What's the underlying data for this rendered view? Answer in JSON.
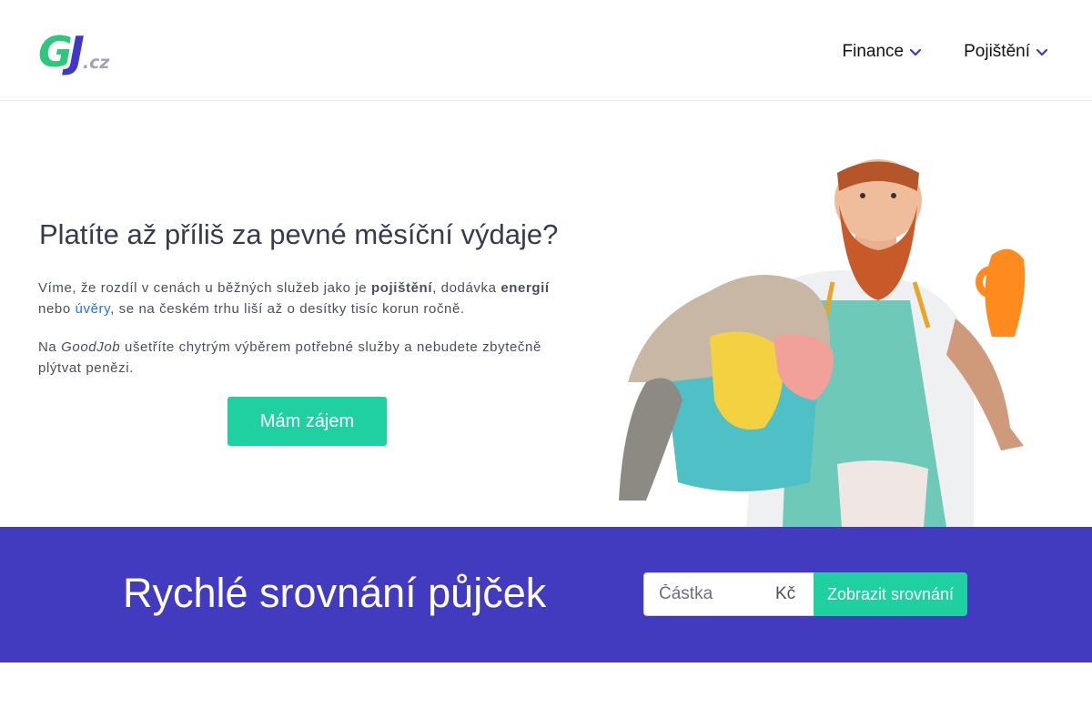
{
  "header": {
    "logo": {
      "main": "GJ",
      "suffix": ".cz"
    },
    "nav": [
      {
        "label": "Finance",
        "icon": "chevron-down-icon"
      },
      {
        "label": "Pojištění",
        "icon": "chevron-down-icon"
      }
    ]
  },
  "hero": {
    "title": "Platíte až příliš za pevné měsíční výdaje?",
    "p1": {
      "t1": "Víme, že rozdíl v cenách u běžných služeb jako je ",
      "b1": "pojištění",
      "t2": ", dodávka ",
      "b2": "energií",
      "t3": " nebo ",
      "link": "úvěry",
      "t4": ", se na českém trhu liší až o desítky tisíc korun ročně."
    },
    "p2": {
      "t1": "Na ",
      "brand": "GoodJob",
      "t2": " ušetříte chytrým výběrem potřebné služby a nebudete zbytečně plýtvat penězi."
    },
    "cta_label": "Mám zájem"
  },
  "compare": {
    "title": "Rychlé srovnání půjček",
    "amount_placeholder": "Částka",
    "unit": "Kč",
    "button_label": "Zobrazit srovnání"
  },
  "colors": {
    "brand_green": "#1fd1a0",
    "brand_purple": "#423bc0",
    "link": "#1a73e8"
  }
}
